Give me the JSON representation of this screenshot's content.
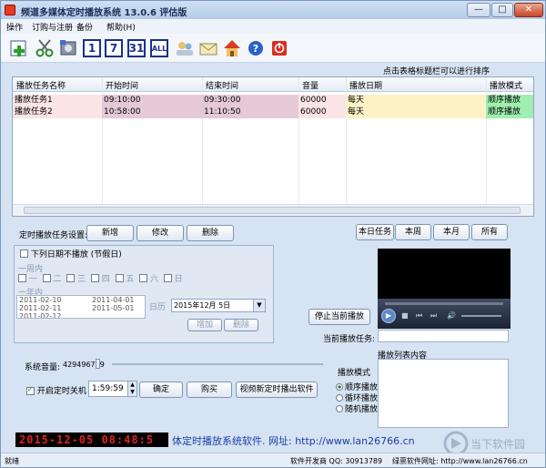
{
  "window": {
    "title": "频道多媒体定时播放系统 13.0.6 评估版",
    "controls": {
      "minimize": "—",
      "maximize": "□",
      "close": "✕"
    }
  },
  "menu": [
    "操作",
    "订购与注册",
    "备份",
    "帮助(H)"
  ],
  "toolbar": [
    {
      "icon": "add-task-icon"
    },
    {
      "icon": "scissors-icon"
    },
    {
      "icon": "film-reel-icon"
    },
    {
      "icon": "calendar-day-icon",
      "text": "1"
    },
    {
      "icon": "calendar-week-icon",
      "text": "7"
    },
    {
      "icon": "calendar-month-icon",
      "text": "31"
    },
    {
      "icon": "calendar-all-icon",
      "text": "ALL"
    },
    {
      "icon": "users-icon"
    },
    {
      "icon": "envelope-icon"
    },
    {
      "icon": "home-icon"
    },
    {
      "icon": "help-icon"
    },
    {
      "icon": "power-icon"
    }
  ],
  "hint": "点击表格标题栏可以进行排序",
  "table": {
    "columns": [
      "播放任务名称",
      "开始时间",
      "结束时间",
      "音量",
      "播放日期",
      "播放模式"
    ],
    "rows": [
      [
        "播放任务1",
        "09:10:00",
        "09:30:00",
        "60000",
        "每天",
        "顺序播放"
      ],
      [
        "播放任务2",
        "10:58:00",
        "11:10:50",
        "60000",
        "每天",
        "顺序播放"
      ]
    ]
  },
  "task_settings": {
    "label": "定时播放任务设置:",
    "buttons": [
      "新增",
      "修改",
      "删除"
    ]
  },
  "filter_buttons": [
    "本日任务",
    "本周",
    "本月",
    "所有"
  ],
  "holiday_group": {
    "checkbox_label": "下列日期不播放 (节假日)",
    "week_label": "一周内",
    "weekdays": [
      "一",
      "二",
      "三",
      "四",
      "五",
      "六",
      "日"
    ],
    "year_label": "一年内",
    "dates_col1": [
      "2011-02-10",
      "2011-02-11",
      "2011-02-12"
    ],
    "dates_col2": [
      "2011-04-01",
      "2011-05-01"
    ],
    "calendar_label": "日历",
    "date_value": "2015年12月 5日",
    "add_label": "增加",
    "delete_label": "删除"
  },
  "player": {
    "stop_label": "停止当前播放",
    "current_task_label": "当前播放任务:",
    "current_task_value": ""
  },
  "volume": {
    "label": "系统音量:",
    "value": "429496729"
  },
  "shutdown": {
    "checkbox_label": "开启定时关机",
    "checked": true,
    "time": "1:59:59",
    "buttons": [
      "确定",
      "购买",
      "视频新定时播出软件"
    ]
  },
  "playlist": {
    "label": "播放列表内容",
    "mode_label": "播放模式",
    "modes": [
      {
        "label": "顺序播放",
        "selected": true
      },
      {
        "label": "循环播放",
        "selected": false
      },
      {
        "label": "随机播放",
        "selected": false
      }
    ]
  },
  "clock": "2015-12-05 08:48:5",
  "marquee": "体定时播放系统软件. 网址: http://www.lan26766.cn",
  "statusbar": {
    "left": "就绪",
    "vendor": "软件开发商 QQ: 30913789",
    "website": "绿禀软件网址: http://www.lan26766.cn"
  },
  "watermark": "当下软件园",
  "colors": {
    "row_name_bg": "#fbe4e6",
    "row_time_bg": "#e6c9d6",
    "row_date_bg": "#fbf3c6",
    "row_mode_bg": "#9ff0b0",
    "clock_fg": "#e02020",
    "marquee_fg": "#1b3ea8"
  }
}
